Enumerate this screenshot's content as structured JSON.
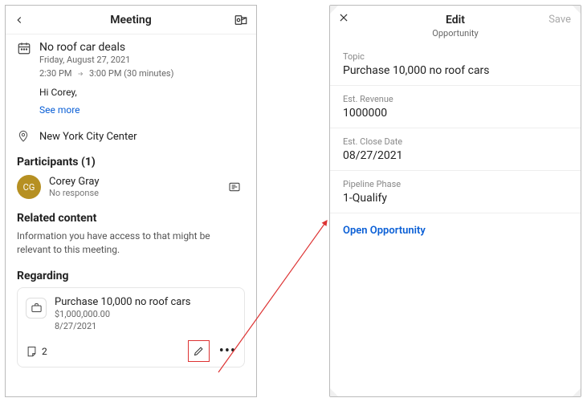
{
  "left": {
    "header": {
      "title": "Meeting"
    },
    "event": {
      "title": "No roof car deals",
      "date": "Friday, August 27, 2021",
      "time_start": "2:30 PM",
      "time_end": "3:00 PM",
      "duration": "(30 minutes)",
      "greeting": "Hi Corey,",
      "see_more": "See more",
      "location": "New York City Center"
    },
    "participants": {
      "heading": "Participants (1)",
      "list": [
        {
          "initials": "CG",
          "name": "Corey Gray",
          "response": "No response"
        }
      ]
    },
    "related": {
      "heading": "Related content",
      "desc": "Information you have access to that might be relevant to this meeting."
    },
    "regarding": {
      "heading": "Regarding",
      "card": {
        "title": "Purchase 10,000 no roof cars",
        "revenue": "$1,000,000.00",
        "date": "8/27/2021",
        "notes_count": "2"
      }
    }
  },
  "right": {
    "header": {
      "title": "Edit",
      "subtitle": "Opportunity",
      "save": "Save"
    },
    "fields": {
      "topic_label": "Topic",
      "topic_value": "Purchase 10,000 no roof cars",
      "revenue_label": "Est. Revenue",
      "revenue_value": "1000000",
      "close_label": "Est. Close Date",
      "close_value": "08/27/2021",
      "phase_label": "Pipeline Phase",
      "phase_value": "1-Qualify"
    },
    "open_link": "Open Opportunity"
  }
}
